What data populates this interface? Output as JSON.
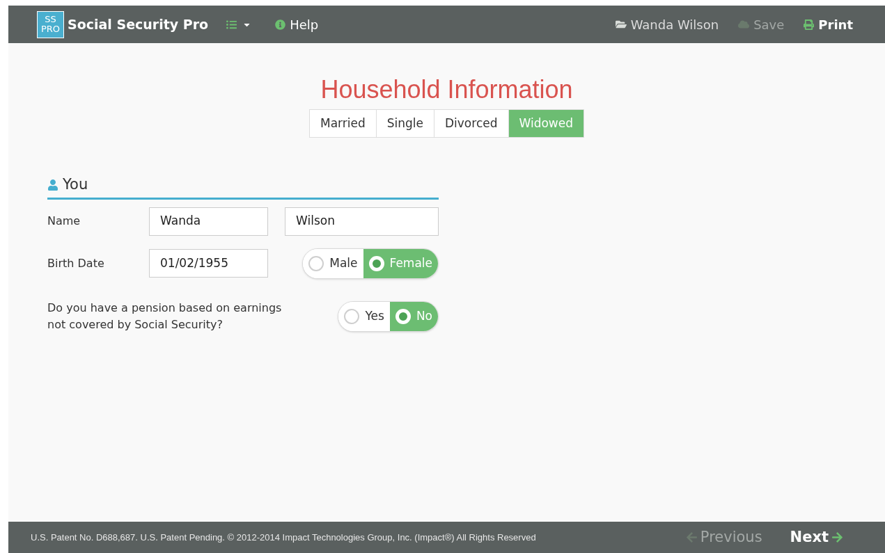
{
  "brand": {
    "logo_top": "SS",
    "logo_bottom": "PRO",
    "name": "Social Security Pro"
  },
  "nav_left": [
    {
      "kind": "menu"
    },
    {
      "kind": "help",
      "label": "Help"
    }
  ],
  "nav_right": [
    {
      "kind": "file",
      "label": "Wanda Wilson",
      "disabled": false
    },
    {
      "kind": "save",
      "label": "Save",
      "disabled": true
    },
    {
      "kind": "print",
      "label": "Print",
      "disabled": false
    }
  ],
  "title": "Household Information",
  "tabs": [
    {
      "label": "Married",
      "selected": false
    },
    {
      "label": "Single",
      "selected": false
    },
    {
      "label": "Divorced",
      "selected": false
    },
    {
      "label": "Widowed",
      "selected": true
    }
  ],
  "section": {
    "heading": "You",
    "name_label": "Name",
    "first_name": "Wanda",
    "last_name": "Wilson",
    "birth_label": "Birth Date",
    "birth_date": "01/02/1955",
    "gender": [
      {
        "label": "Male",
        "selected": false
      },
      {
        "label": "Female",
        "selected": true
      }
    ],
    "pension_question": "Do you have a pension based on earnings not covered by Social Security?",
    "pension": [
      {
        "label": "Yes",
        "selected": false
      },
      {
        "label": "No",
        "selected": true
      }
    ]
  },
  "footer": {
    "legal": "U.S. Patent No. D688,687. U.S. Patent Pending. © 2012-2014 Impact Technologies Group, Inc. (Impact®) All Rights Reserved",
    "previous": {
      "label": "Previous",
      "disabled": true
    },
    "next": {
      "label": "Next",
      "disabled": false
    }
  }
}
